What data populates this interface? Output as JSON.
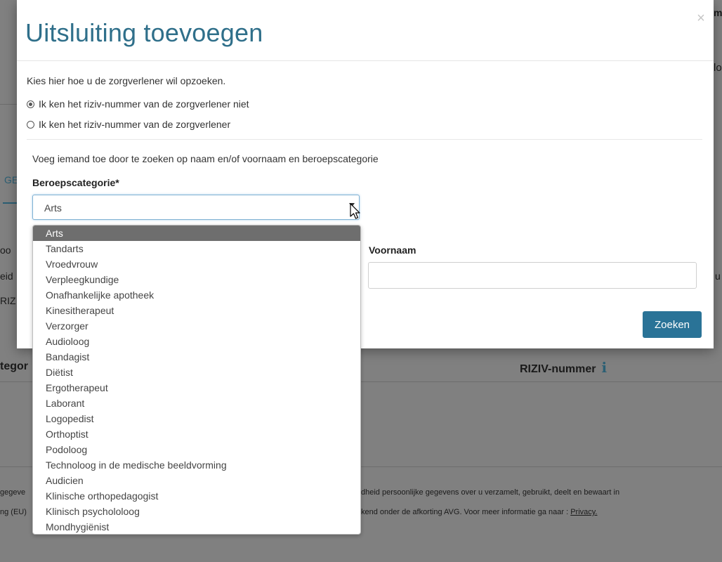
{
  "background": {
    "fragments": {
      "top_right": "ma",
      "mid_right": "lo",
      "tab": "GE",
      "row1_left": "oo",
      "row2_left": "eid",
      "row3_left": "RIZ",
      "right_edge": "u",
      "category_header": "tegor",
      "riziv_header": "RIZIV-nummer",
      "info_icon": "i",
      "footer1_left": "gegeve",
      "footer1_right": "dheid persoonlijke gegevens over u verzamelt, gebruikt, deelt en bewaart in",
      "footer2_left": "ng (EU)",
      "footer2_right": "kend onder de afkorting AVG. Voor meer informatie ga naar : ",
      "footer2_link": "Privacy."
    }
  },
  "modal": {
    "title": "Uitsluiting toevoegen",
    "close_label": "×",
    "intro": "Kies hier hoe u de zorgverlener wil opzoeken.",
    "radio_options": [
      {
        "label": "Ik ken het riziv-nummer van de zorgverlener niet",
        "checked": true
      },
      {
        "label": "Ik ken het riziv-nummer van de zorgverlener",
        "checked": false
      }
    ],
    "instruction": "Voeg iemand toe door te zoeken op naam en/of voornaam en beroepscategorie",
    "category_label": "Beroepscategorie*",
    "category_value": "Arts",
    "firstname_label": "Voornaam",
    "firstname_value": "",
    "search_button": "Zoeken"
  },
  "dropdown": {
    "selected": "Arts",
    "options": [
      "Arts",
      "Tandarts",
      "Vroedvrouw",
      "Verpleegkundige",
      "Onafhankelijke apotheek",
      "Kinesitherapeut",
      "Verzorger",
      "Audioloog",
      "Bandagist",
      "Diëtist",
      "Ergotherapeut",
      "Laborant",
      "Logopedist",
      "Orthoptist",
      "Podoloog",
      "Technoloog in de medische beeldvorming",
      "Audicien",
      "Klinische orthopedagogist",
      "Klinisch psychololoog",
      "Mondhygiënist"
    ]
  },
  "colors": {
    "title": "#2f6f8a",
    "button": "#2a7397",
    "selected_option": "#6e6e6e",
    "overlay": "#808080"
  }
}
